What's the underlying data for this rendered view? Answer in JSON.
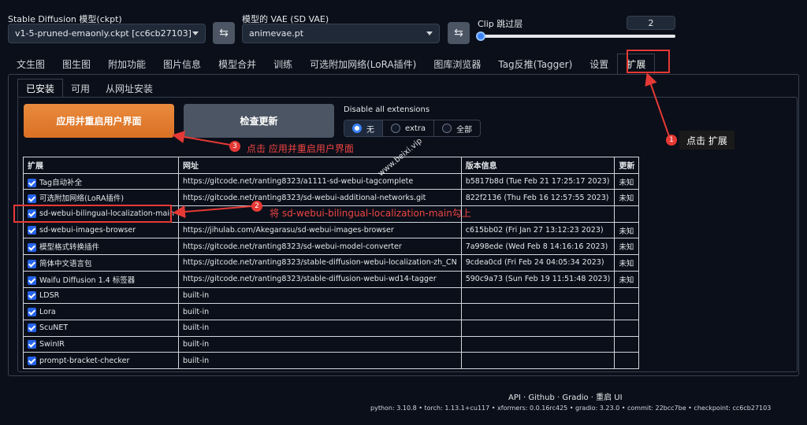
{
  "header": {
    "checkpoint_label": "Stable Diffusion 模型(ckpt)",
    "checkpoint_value": "v1-5-pruned-emaonly.ckpt [cc6cb27103]",
    "vae_label": "模型的 VAE (SD VAE)",
    "vae_value": "animevae.pt",
    "clip_label": "Clip 跳过层",
    "clip_value": "2",
    "refresh_icon": "⇆"
  },
  "main_tabs": [
    "文生图",
    "图生图",
    "附加功能",
    "图片信息",
    "模型合并",
    "训练",
    "可选附加网络(LoRA插件)",
    "图库浏览器",
    "Tag反推(Tagger)",
    "设置",
    "扩展"
  ],
  "sub_tabs": [
    "已安装",
    "可用",
    "从网址安装"
  ],
  "buttons": {
    "apply": "应用并重启用户界面",
    "check": "检查更新"
  },
  "disable": {
    "label": "Disable all extensions",
    "options": [
      "无",
      "extra",
      "全部"
    ],
    "selected": "无"
  },
  "table": {
    "headers": [
      "扩展",
      "网址",
      "版本信息",
      "更新"
    ],
    "rows": [
      {
        "name": "Tag自动补全",
        "url": "https://gitcode.net/ranting8323/a1111-sd-webui-tagcomplete",
        "version": "b5817b8d (Tue Feb 21 17:25:17 2023)",
        "update": "未知"
      },
      {
        "name": "可选附加网络(LoRA插件)",
        "url": "https://gitcode.net/ranting8323/sd-webui-additional-networks.git",
        "version": "822f2136 (Thu Feb 16 12:57:55 2023)",
        "update": "未知"
      },
      {
        "name": "sd-webui-bilingual-localization-main",
        "url": "",
        "version": "",
        "update": ""
      },
      {
        "name": "sd-webui-images-browser",
        "url": "https://jihulab.com/Akegarasu/sd-webui-images-browser",
        "version": "c615bb02 (Fri Jan 27 13:12:23 2023)",
        "update": "未知"
      },
      {
        "name": "模型格式转换插件",
        "url": "https://gitcode.net/ranting8323/sd-webui-model-converter",
        "version": "7a998ede (Wed Feb 8 14:16:16 2023)",
        "update": "未知"
      },
      {
        "name": "简体中文语言包",
        "url": "https://gitcode.net/ranting8323/stable-diffusion-webui-localization-zh_CN",
        "version": "9cdea0cd (Fri Feb 24 04:05:34 2023)",
        "update": "未知"
      },
      {
        "name": "Waifu Diffusion 1.4 标签器",
        "url": "https://gitcode.net/ranting8323/stable-diffusion-webui-wd14-tagger",
        "version": "590c9a73 (Sun Feb 19 11:51:48 2023)",
        "update": "未知"
      },
      {
        "name": "LDSR",
        "url": "built-in",
        "version": "",
        "update": ""
      },
      {
        "name": "Lora",
        "url": "built-in",
        "version": "",
        "update": ""
      },
      {
        "name": "ScuNET",
        "url": "built-in",
        "version": "",
        "update": ""
      },
      {
        "name": "SwinIR",
        "url": "built-in",
        "version": "",
        "update": ""
      },
      {
        "name": "prompt-bracket-checker",
        "url": "built-in",
        "version": "",
        "update": ""
      }
    ]
  },
  "annotations": {
    "step1_num": "1",
    "step1_text": "点击 扩展",
    "step2_num": "2",
    "step2_text": "将 sd-webui-bilingual-localization-main勾上",
    "step3_num": "3",
    "step3_text": "点击 应用并重启用户界面",
    "watermark": "www.beixi.vip",
    "color": "#e53935"
  },
  "footer": {
    "links": "API · Github · Gradio · 重启 UI",
    "info": "python: 3.10.8  •  torch: 1.13.1+cu117  •  xformers: 0.0.16rc425  •  gradio: 3.23.0  •  commit: 22bcc7be  •  checkpoint: cc6cb27103"
  }
}
